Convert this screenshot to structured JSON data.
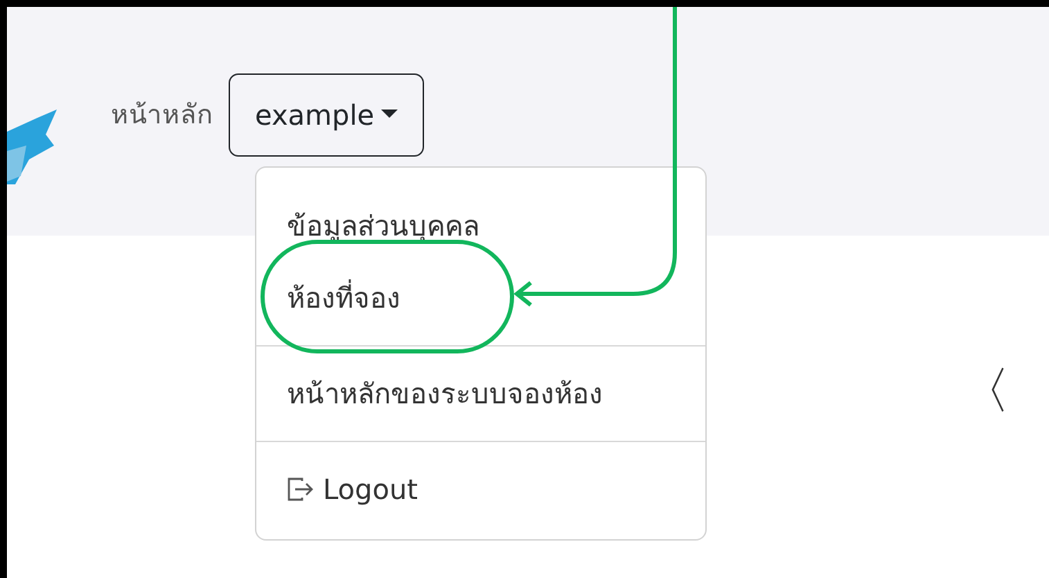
{
  "navbar": {
    "home_link": "หน้าหลัก",
    "user_dropdown": {
      "label": "example",
      "expanded": true,
      "items": [
        {
          "kind": "item",
          "label": "ข้อมูลส่วนบุคคล",
          "highlighted": false
        },
        {
          "kind": "item",
          "label": "ห้องที่จอง",
          "highlighted": true
        },
        {
          "kind": "divider"
        },
        {
          "kind": "item",
          "label": "หน้าหลักของระบบจองห้อง",
          "highlighted": false
        },
        {
          "kind": "divider"
        },
        {
          "kind": "logout",
          "label": "Logout",
          "highlighted": false
        }
      ]
    }
  },
  "carousel": {
    "prev_control": "〈"
  }
}
